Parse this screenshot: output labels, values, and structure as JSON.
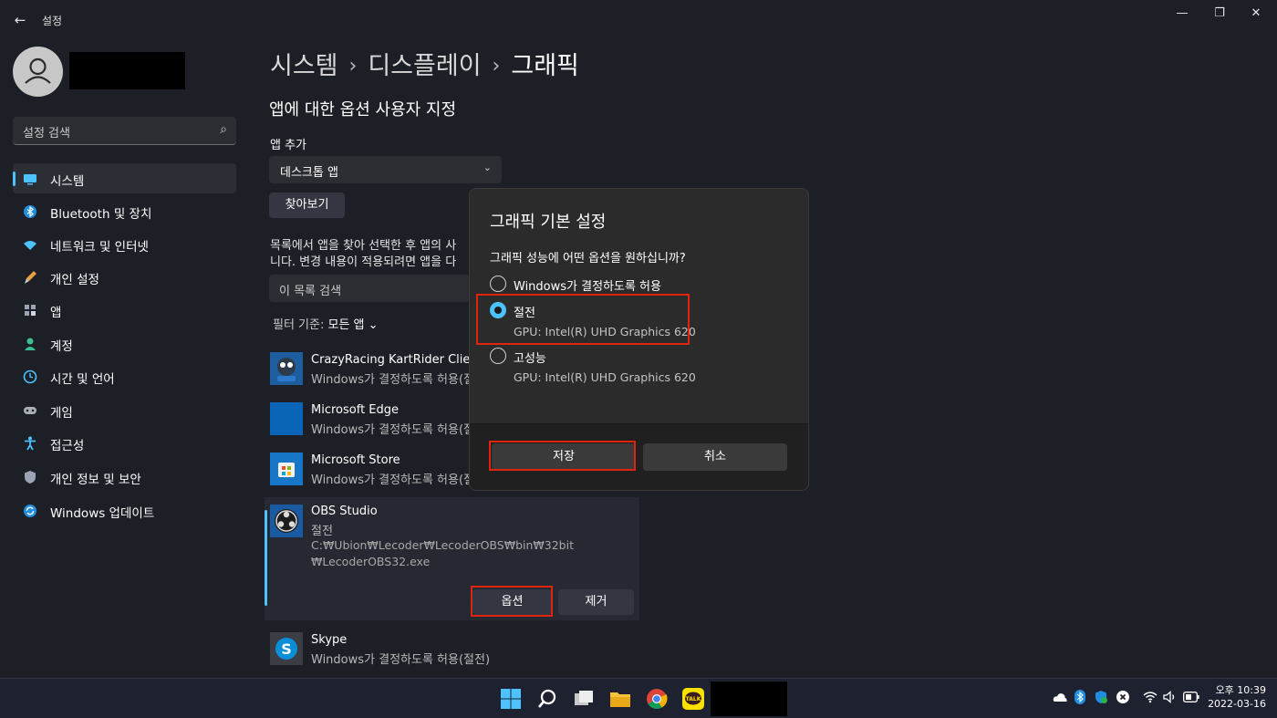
{
  "window": {
    "title": "설정",
    "back": "←",
    "minimize": "—",
    "restore": "❐",
    "close": "✕"
  },
  "sidebar": {
    "search_placeholder": "설정 검색",
    "search_icon": "⌕",
    "items": [
      {
        "label": "시스템",
        "icon": "monitor-icon",
        "selected": true
      },
      {
        "label": "Bluetooth 및 장치",
        "icon": "bluetooth-icon"
      },
      {
        "label": "네트워크 및 인터넷",
        "icon": "wifi-icon"
      },
      {
        "label": "개인 설정",
        "icon": "brush-icon"
      },
      {
        "label": "앱",
        "icon": "apps-icon"
      },
      {
        "label": "계정",
        "icon": "person-icon"
      },
      {
        "label": "시간 및 언어",
        "icon": "globe-clock-icon"
      },
      {
        "label": "게임",
        "icon": "gamepad-icon"
      },
      {
        "label": "접근성",
        "icon": "accessibility-icon"
      },
      {
        "label": "개인 정보 및 보안",
        "icon": "shield-icon"
      },
      {
        "label": "Windows 업데이트",
        "icon": "update-icon"
      }
    ]
  },
  "breadcrumb": {
    "part1": "시스템",
    "part2": "디스플레이",
    "current": "그래픽",
    "separator": "›"
  },
  "main": {
    "section_title": "앱에 대한 옵션 사용자 지정",
    "add_app_label": "앱 추가",
    "app_type_value": "데스크톱 앱",
    "browse_label": "찾아보기",
    "description_line1": "목록에서 앱을 찾아 선택한 후 앱의 사",
    "description_line2": "니다. 변경 내용이 적용되려면 앱을 다",
    "list_search_placeholder": "이 목록 검색",
    "filter_label": "필터 기준:",
    "filter_value": "모든 앱",
    "apps": [
      {
        "name": "CrazyRacing KartRider Client",
        "status": "Windows가 결정하도록 허용(절전)"
      },
      {
        "name": "Microsoft Edge",
        "status": "Windows가 결정하도록 허용(절전)"
      },
      {
        "name": "Microsoft Store",
        "status": "Windows가 결정하도록 허용(절전)"
      }
    ],
    "obs": {
      "name": "OBS Studio",
      "status": "절전",
      "path_line1": "C:₩Ubion₩Lecoder₩LecoderOBS₩bin₩32bit",
      "path_line2": "₩LecoderOBS32.exe",
      "options_label": "옵션",
      "remove_label": "제거"
    },
    "skype": {
      "name": "Skype",
      "status": "Windows가 결정하도록 허용(절전)"
    }
  },
  "dialog": {
    "title": "그래픽 기본 설정",
    "question": "그래픽 성능에 어떤 옵션을 원하십니까?",
    "options": [
      {
        "label": "Windows가 결정하도록 허용",
        "selected": false
      },
      {
        "label": "절전",
        "gpu": "GPU: Intel(R) UHD Graphics 620",
        "selected": true
      },
      {
        "label": "고성능",
        "gpu": "GPU: Intel(R) UHD Graphics 620",
        "selected": false
      }
    ],
    "save_label": "저장",
    "cancel_label": "취소"
  },
  "taskbar": {
    "apps": [
      "windows-start-icon",
      "search-icon",
      "task-view-icon",
      "file-explorer-icon",
      "chrome-icon",
      "kakaotalk-icon"
    ],
    "kakao_text": "TALK",
    "tray": [
      "onedrive-icon",
      "bluetooth-icon",
      "security-icon",
      "x-app-icon",
      "wifi-icon",
      "volume-icon",
      "battery-icon"
    ],
    "time": "오후 10:39",
    "date": "2022-03-16"
  },
  "colors": {
    "accent": "#4cc2ff",
    "highlight": "#e0250f",
    "background": "#1c1f26"
  }
}
